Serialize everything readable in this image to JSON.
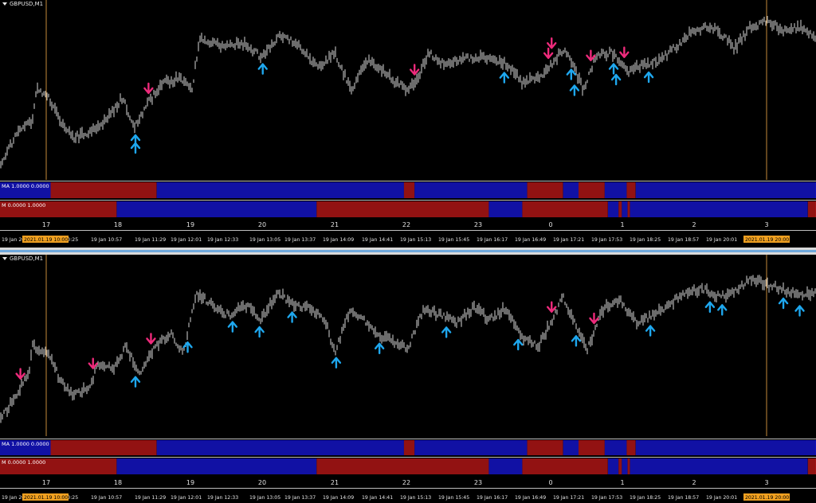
{
  "symbol_title": "GBPUSD,M1",
  "indicator_ma_label": "MA 1.0000 0.0000",
  "indicator_m_label": "M 0.0000 1.0000",
  "hour_labels": [
    "17",
    "18",
    "19",
    "20",
    "21",
    "22",
    "23",
    "0",
    "1",
    "2",
    "3"
  ],
  "time_labels": [
    "19 Jan 20",
    "19 Jan 10:25",
    "19 Jan 10:57",
    "19 Jan 11:29",
    "19 Jan 12:01",
    "19 Jan 12:33",
    "19 Jan 13:05",
    "19 Jan 13:37",
    "19 Jan 14:09",
    "19 Jan 14:41",
    "19 Jan 15:13",
    "19 Jan 15:45",
    "19 Jan 16:17",
    "19 Jan 16:49",
    "19 Jan 17:21",
    "19 Jan 17:53",
    "19 Jan 18:25",
    "19 Jan 18:57",
    "19 Jan 20:01",
    "19 J"
  ],
  "highlight_labels": [
    "2021.01.19 10:00",
    "2021.01.19 20:00"
  ],
  "colors": {
    "background": "#000000",
    "candles": "#d8d8d8",
    "arrow_up": "#1ea7ee",
    "arrow_down": "#ee2a7b",
    "band_red": "#a31414",
    "band_blue": "#1313b8",
    "vline": "#c48a3a",
    "highlight": "#f0a020"
  },
  "ma_band_segments": [
    [
      "blue",
      0,
      0.062
    ],
    [
      "red",
      0.062,
      0.192
    ],
    [
      "blue",
      0.192,
      0.495
    ],
    [
      "red",
      0.495,
      0.508
    ],
    [
      "blue",
      0.508,
      0.646
    ],
    [
      "red",
      0.646,
      0.69
    ],
    [
      "blue",
      0.69,
      0.709
    ],
    [
      "red",
      0.709,
      0.741
    ],
    [
      "blue",
      0.741,
      0.768
    ],
    [
      "red",
      0.768,
      0.779
    ],
    [
      "blue",
      0.779,
      1.0
    ]
  ],
  "m_band_segments": [
    [
      "red",
      0,
      0.143
    ],
    [
      "blue",
      0.143,
      0.388
    ],
    [
      "red",
      0.388,
      0.599
    ],
    [
      "blue",
      0.599,
      0.64
    ],
    [
      "red",
      0.64,
      0.745
    ],
    [
      "blue",
      0.745,
      0.758
    ],
    [
      "red",
      0.758,
      0.762
    ],
    [
      "blue",
      0.762,
      0.769
    ],
    [
      "red",
      0.769,
      0.772
    ],
    [
      "blue",
      0.772,
      0.99
    ],
    [
      "red",
      0.99,
      1.0
    ]
  ],
  "chart_data": [
    {
      "type": "candlestick",
      "title": "GBPUSD,M1",
      "price_anchors": [
        [
          0,
          208
        ],
        [
          0.02,
          170
        ],
        [
          0.04,
          150
        ],
        [
          0.045,
          110
        ],
        [
          0.06,
          120
        ],
        [
          0.075,
          155
        ],
        [
          0.09,
          175
        ],
        [
          0.11,
          165
        ],
        [
          0.13,
          150
        ],
        [
          0.15,
          120
        ],
        [
          0.165,
          160
        ],
        [
          0.18,
          130
        ],
        [
          0.2,
          100
        ],
        [
          0.22,
          95
        ],
        [
          0.235,
          110
        ],
        [
          0.245,
          40
        ],
        [
          0.27,
          50
        ],
        [
          0.3,
          48
        ],
        [
          0.32,
          65
        ],
        [
          0.345,
          35
        ],
        [
          0.37,
          55
        ],
        [
          0.39,
          80
        ],
        [
          0.41,
          60
        ],
        [
          0.43,
          110
        ],
        [
          0.45,
          70
        ],
        [
          0.47,
          85
        ],
        [
          0.485,
          100
        ],
        [
          0.5,
          110
        ],
        [
          0.51,
          100
        ],
        [
          0.525,
          60
        ],
        [
          0.54,
          75
        ],
        [
          0.56,
          70
        ],
        [
          0.59,
          65
        ],
        [
          0.62,
          75
        ],
        [
          0.64,
          100
        ],
        [
          0.66,
          95
        ],
        [
          0.68,
          70
        ],
        [
          0.69,
          55
        ],
        [
          0.7,
          70
        ],
        [
          0.715,
          110
        ],
        [
          0.73,
          65
        ],
        [
          0.75,
          60
        ],
        [
          0.77,
          85
        ],
        [
          0.79,
          75
        ],
        [
          0.81,
          70
        ],
        [
          0.83,
          50
        ],
        [
          0.85,
          30
        ],
        [
          0.87,
          25
        ],
        [
          0.89,
          40
        ],
        [
          0.9,
          55
        ],
        [
          0.92,
          25
        ],
        [
          0.94,
          18
        ],
        [
          0.96,
          30
        ],
        [
          0.98,
          25
        ],
        [
          1.0,
          40
        ]
      ],
      "arrows": [
        {
          "dir": "up",
          "x": 0.166
        },
        {
          "dir": "up",
          "x": 0.166
        },
        {
          "dir": "down",
          "x": 0.182
        },
        {
          "dir": "up",
          "x": 0.322
        },
        {
          "dir": "down",
          "x": 0.508
        },
        {
          "dir": "up",
          "x": 0.618
        },
        {
          "dir": "down",
          "x": 0.672
        },
        {
          "dir": "down",
          "x": 0.676
        },
        {
          "dir": "up",
          "x": 0.7
        },
        {
          "dir": "up",
          "x": 0.704
        },
        {
          "dir": "down",
          "x": 0.724
        },
        {
          "dir": "up",
          "x": 0.752
        },
        {
          "dir": "up",
          "x": 0.755
        },
        {
          "dir": "down",
          "x": 0.765
        },
        {
          "dir": "up",
          "x": 0.795
        }
      ]
    },
    {
      "type": "candlestick",
      "title": "GBPUSD,M1",
      "price_anchors": [
        [
          0,
          210
        ],
        [
          0.02,
          175
        ],
        [
          0.035,
          150
        ],
        [
          0.04,
          110
        ],
        [
          0.06,
          120
        ],
        [
          0.075,
          160
        ],
        [
          0.09,
          175
        ],
        [
          0.11,
          165
        ],
        [
          0.12,
          135
        ],
        [
          0.14,
          140
        ],
        [
          0.155,
          110
        ],
        [
          0.17,
          150
        ],
        [
          0.19,
          110
        ],
        [
          0.21,
          95
        ],
        [
          0.225,
          120
        ],
        [
          0.24,
          40
        ],
        [
          0.26,
          55
        ],
        [
          0.28,
          70
        ],
        [
          0.3,
          55
        ],
        [
          0.32,
          75
        ],
        [
          0.34,
          40
        ],
        [
          0.36,
          55
        ],
        [
          0.38,
          60
        ],
        [
          0.4,
          80
        ],
        [
          0.41,
          120
        ],
        [
          0.43,
          60
        ],
        [
          0.45,
          80
        ],
        [
          0.47,
          100
        ],
        [
          0.49,
          110
        ],
        [
          0.5,
          115
        ],
        [
          0.52,
          60
        ],
        [
          0.54,
          70
        ],
        [
          0.56,
          80
        ],
        [
          0.58,
          60
        ],
        [
          0.6,
          75
        ],
        [
          0.62,
          60
        ],
        [
          0.64,
          100
        ],
        [
          0.66,
          110
        ],
        [
          0.68,
          70
        ],
        [
          0.69,
          45
        ],
        [
          0.71,
          95
        ],
        [
          0.72,
          115
        ],
        [
          0.74,
          60
        ],
        [
          0.76,
          50
        ],
        [
          0.78,
          80
        ],
        [
          0.8,
          70
        ],
        [
          0.82,
          55
        ],
        [
          0.84,
          40
        ],
        [
          0.86,
          35
        ],
        [
          0.88,
          45
        ],
        [
          0.9,
          40
        ],
        [
          0.92,
          20
        ],
        [
          0.94,
          30
        ],
        [
          0.96,
          35
        ],
        [
          0.98,
          45
        ],
        [
          1.0,
          40
        ]
      ],
      "arrows": [
        {
          "dir": "down",
          "x": 0.025
        },
        {
          "dir": "down",
          "x": 0.114
        },
        {
          "dir": "up",
          "x": 0.166
        },
        {
          "dir": "down",
          "x": 0.185
        },
        {
          "dir": "up",
          "x": 0.23
        },
        {
          "dir": "up",
          "x": 0.285
        },
        {
          "dir": "up",
          "x": 0.318
        },
        {
          "dir": "up",
          "x": 0.358
        },
        {
          "dir": "up",
          "x": 0.412
        },
        {
          "dir": "up",
          "x": 0.465
        },
        {
          "dir": "up",
          "x": 0.547
        },
        {
          "dir": "up",
          "x": 0.635
        },
        {
          "dir": "down",
          "x": 0.676
        },
        {
          "dir": "up",
          "x": 0.706
        },
        {
          "dir": "down",
          "x": 0.728
        },
        {
          "dir": "up",
          "x": 0.797
        },
        {
          "dir": "up",
          "x": 0.87
        },
        {
          "dir": "up",
          "x": 0.885
        },
        {
          "dir": "up",
          "x": 0.96
        },
        {
          "dir": "up",
          "x": 0.98
        }
      ]
    }
  ]
}
